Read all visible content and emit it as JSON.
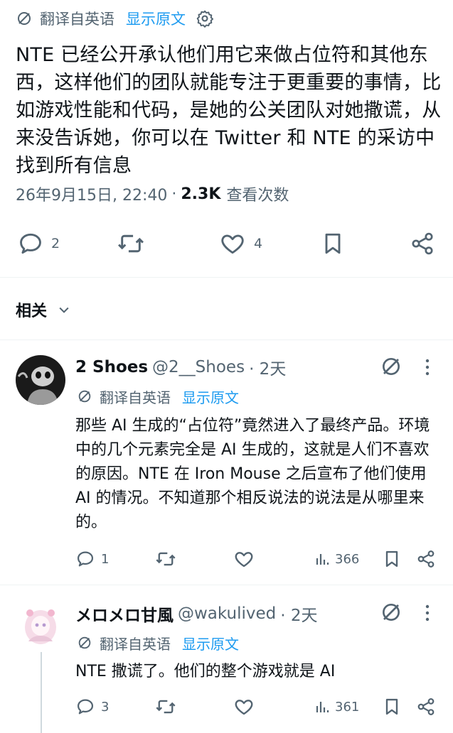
{
  "top_translate": {
    "label": "翻译自英语",
    "link": "显示原文"
  },
  "post": {
    "text": "NTE 已经公开承认他们用它来做占位符和其他东西，这样他们的团队就能专注于更重要的事情，比如游戏性能和代码，是她的公关团队对她撒谎，从来没告诉她，你可以在 Twitter 和 NTE 的采访中找到所有信息",
    "timestamp": "26年9月15日, 22:40",
    "separator": "·",
    "views_count": "2.3K",
    "views_label": "查看次数",
    "replies": "2",
    "likes": "4"
  },
  "related": {
    "label": "相关"
  },
  "replies": [
    {
      "name": "2 Shoes",
      "handle": "@2__Shoes",
      "time": "· 2天",
      "translate_label": "翻译自英语",
      "translate_link": "显示原文",
      "text": "那些 AI 生成的“占位符”竟然进入了最终产品。环境中的几个元素完全是 AI 生成的，这就是人们不喜欢的原因。NTE 在 Iron Mouse 之后宣布了他们使用 AI 的情况。不知道那个相反说法的说法是从哪里来的。",
      "replies": "1",
      "views": "366"
    },
    {
      "name": "メロメロ甘風",
      "handle": "@wakulived",
      "time": "· 2天",
      "translate_label": "翻译自英语",
      "translate_link": "显示原文",
      "text": "NTE 撒谎了。他们的整个游戏就是 AI",
      "replies": "3",
      "views": "361"
    }
  ],
  "colors": {
    "accent": "#1d9bf0",
    "muted": "#536471",
    "text": "#0f1419",
    "divider": "#eff3f4"
  }
}
